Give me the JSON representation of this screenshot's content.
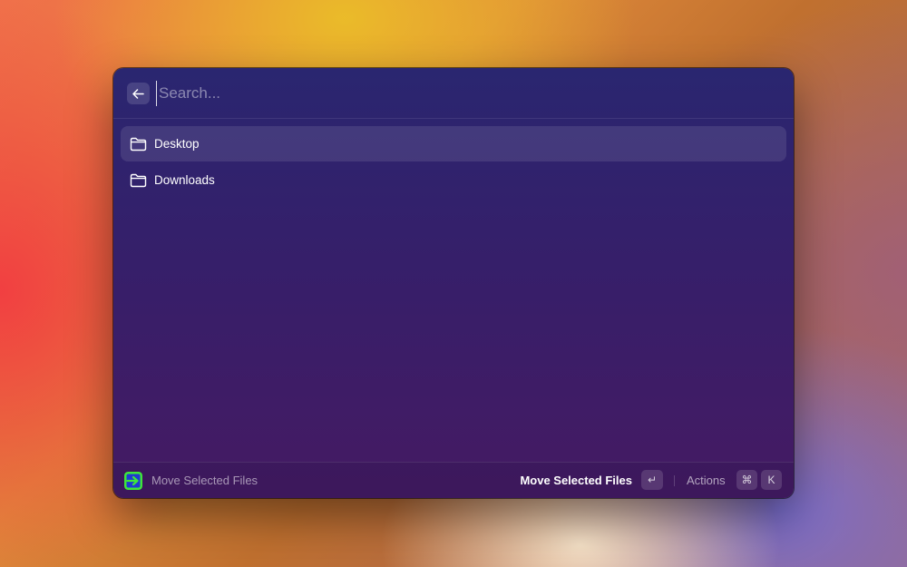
{
  "search": {
    "placeholder": "Search...",
    "value": ""
  },
  "list": {
    "items": [
      {
        "label": "Desktop",
        "icon": "folder-icon",
        "selected": true
      },
      {
        "label": "Downloads",
        "icon": "folder-icon",
        "selected": false
      }
    ]
  },
  "footer": {
    "extension_name": "Move Selected Files",
    "extension_icon": "move-files-extension-icon",
    "primary_action_label": "Move Selected Files",
    "primary_action_shortcut": "↵",
    "actions_label": "Actions",
    "actions_shortcut_modifier": "⌘",
    "actions_shortcut_key": "K"
  },
  "colors": {
    "window_top": "#2a2670",
    "window_bottom": "#451a63",
    "selection": "rgba(255,255,255,0.10)",
    "extension_icon_green": "#3ee63a",
    "extension_icon_blue": "#1f3ad0"
  }
}
